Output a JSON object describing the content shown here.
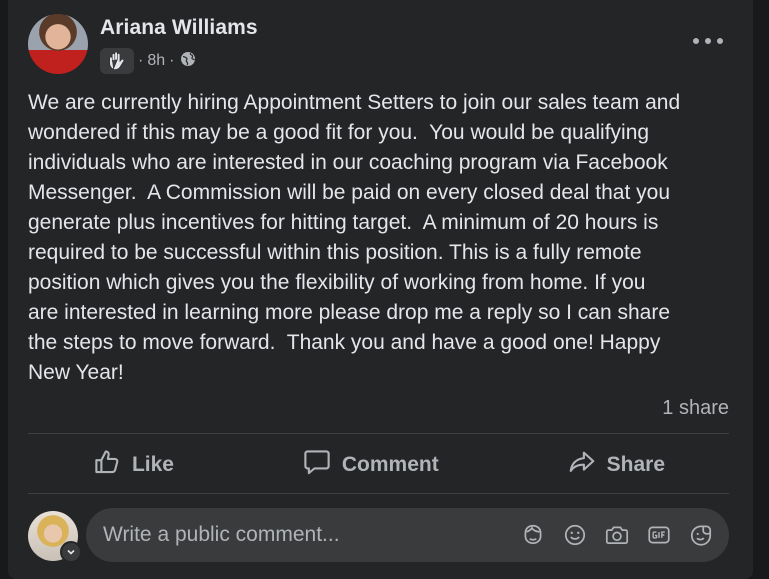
{
  "post": {
    "author": "Ariana Williams",
    "time": "8h",
    "audience_icon": "globe-icon",
    "badge_icon": "wave-hand-icon",
    "text": "We are currently hiring Appointment Setters to join our sales team and\nwondered if this may be a good fit for you.  You would be qualifying\nindividuals who are interested in our coaching program via Facebook\nMessenger.  A Commission will be paid on every closed deal that you\ngenerate plus incentives for hitting target.  A minimum of 20 hours is\nrequired to be successful within this position. This is a fully remote\nposition which gives you the flexibility of working from home. If you\nare interested in learning more please drop me a reply so I can share\nthe steps to move forward.  Thank you and have a good one! Happy\nNew Year!",
    "shares": "1 share"
  },
  "actions": {
    "like": "Like",
    "comment": "Comment",
    "share": "Share"
  },
  "comment_box": {
    "placeholder": "Write a public comment...",
    "icons": [
      "avatar-sticker-icon",
      "emoji-icon",
      "camera-icon",
      "gif-icon",
      "sticker-icon"
    ]
  },
  "colors": {
    "card_bg": "#242526",
    "text_primary": "#e4e6eb",
    "text_secondary": "#b0b3b8",
    "input_bg": "#3a3b3c"
  }
}
